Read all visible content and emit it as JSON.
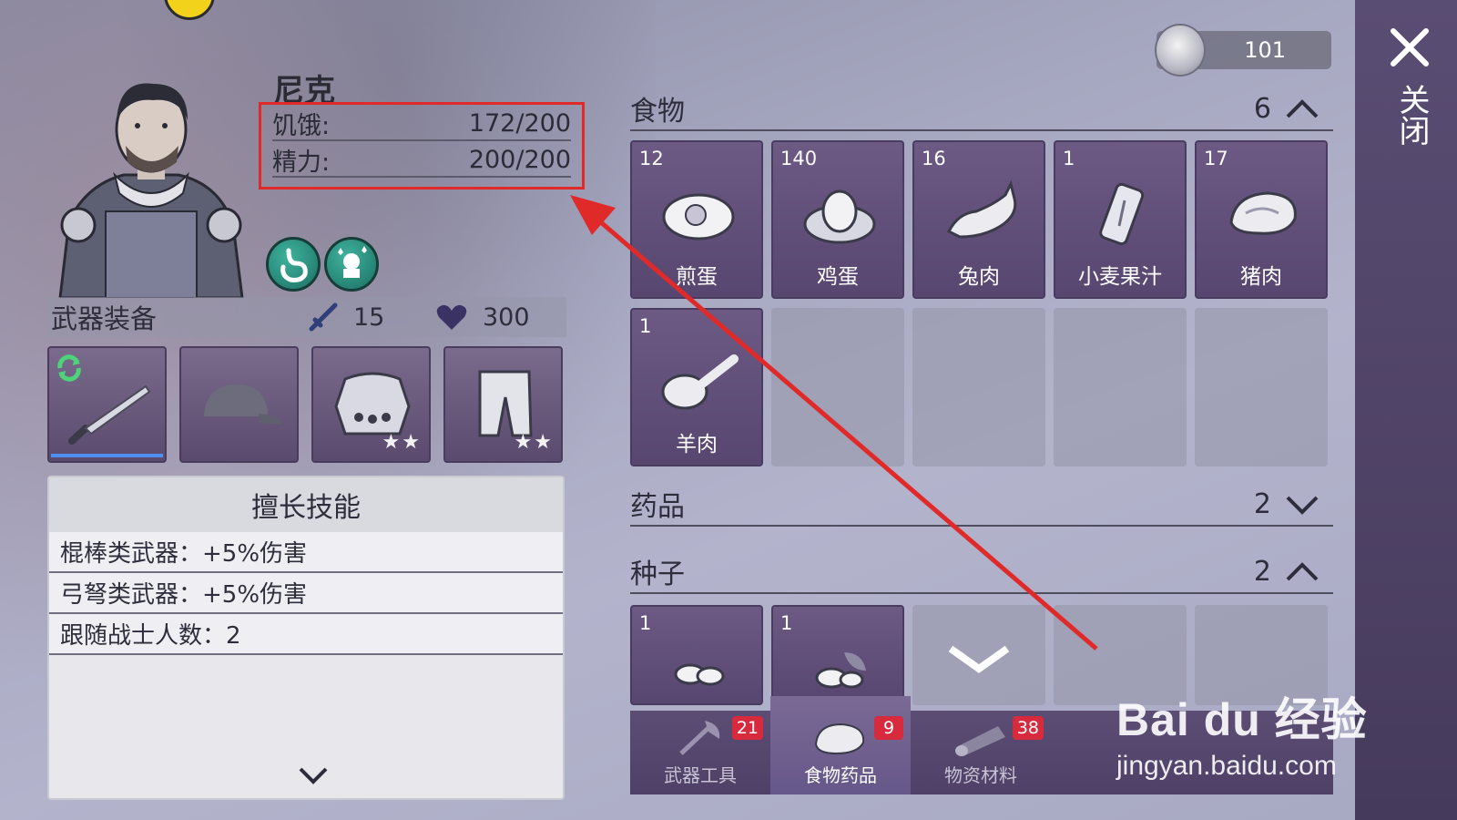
{
  "currency": {
    "amount": "101",
    "icon": "coin-icon"
  },
  "close": {
    "label": "关闭"
  },
  "character": {
    "name": "尼克",
    "stats": [
      {
        "label": "饥饿:",
        "value": "172/200",
        "fraction": 0.86
      },
      {
        "label": "精力:",
        "value": "200/200",
        "fraction": 1.0
      }
    ],
    "status_icons": [
      "stomach-icon",
      "ghost-sparkle-icon"
    ]
  },
  "equipment": {
    "title": "武器装备",
    "attack": "15",
    "health": "300",
    "slots": [
      {
        "icon": "machete-icon",
        "stars": "",
        "refresh": true
      },
      {
        "icon": "cap-icon",
        "stars": ""
      },
      {
        "icon": "armor-vest-icon",
        "stars": "★★"
      },
      {
        "icon": "pants-icon",
        "stars": "★★"
      }
    ]
  },
  "skills": {
    "title": "擅长技能",
    "items": [
      "棍棒类武器：+5%伤害",
      "弓弩类武器：+5%伤害",
      "跟随战士人数：2"
    ]
  },
  "inventory": {
    "sections": [
      {
        "title": "食物",
        "count": "6",
        "expanded": true
      },
      {
        "title": "药品",
        "count": "2",
        "expanded": false
      },
      {
        "title": "种子",
        "count": "2",
        "expanded": true
      }
    ],
    "food_items": [
      {
        "qty": "12",
        "name": "煎蛋",
        "icon": "fried-egg-icon"
      },
      {
        "qty": "140",
        "name": "鸡蛋",
        "icon": "egg-nest-icon"
      },
      {
        "qty": "16",
        "name": "兔肉",
        "icon": "rabbit-icon"
      },
      {
        "qty": "1",
        "name": "小麦果汁",
        "icon": "wheat-can-icon"
      },
      {
        "qty": "17",
        "name": "猪肉",
        "icon": "pork-icon"
      },
      {
        "qty": "1",
        "name": "羊肉",
        "icon": "lamb-leg-icon"
      }
    ],
    "seed_items": [
      {
        "qty": "1",
        "icon": "seeds-icon"
      },
      {
        "qty": "1",
        "icon": "seeds-leaf-icon"
      }
    ]
  },
  "tabs": [
    {
      "label": "武器工具",
      "badge": "21",
      "icon": "axe-tool-icon"
    },
    {
      "label": "食物药品",
      "badge": "9",
      "icon": "meat-icon",
      "selected": true
    },
    {
      "label": "物资材料",
      "badge": "38",
      "icon": "log-icon"
    }
  ],
  "watermark": {
    "brand": "Bai du 经验",
    "url": "jingyan.baidu.com"
  },
  "colors": {
    "accent_purple": "#5a4b6e",
    "badge_red": "#d72a3c",
    "annotation_red": "#e02a2a"
  }
}
